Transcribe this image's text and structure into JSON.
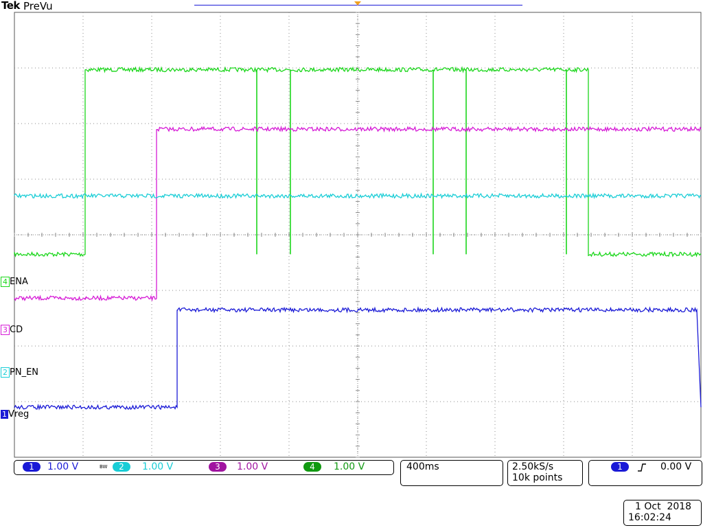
{
  "header": {
    "brand": "Tek",
    "mode": "PreVu"
  },
  "colors": {
    "ch1": "#1a1ad6",
    "ch2": "#19cdd6",
    "ch3": "#d61bd6",
    "ch4": "#1ad61a",
    "grid": "#8a8a8a",
    "trigger": "#f0a020"
  },
  "channels": [
    {
      "number": "1",
      "name": "Vreg",
      "scale": "1.00 V",
      "bw": "",
      "color": "#1a1ad6"
    },
    {
      "number": "2",
      "name": "PN_EN",
      "scale": "1.00 V",
      "bw": "B_W",
      "color": "#19cdd6"
    },
    {
      "number": "3",
      "name": "CD",
      "scale": "1.00 V",
      "bw": "",
      "color": "#d61bd6"
    },
    {
      "number": "4",
      "name": "ENA",
      "scale": "1.00 V",
      "bw": "",
      "color": "#1ad61a"
    }
  ],
  "bw_label": "BW",
  "timebase": {
    "per_div": "400ms"
  },
  "acquisition": {
    "sample_rate": "2.50kS/s",
    "record_length": "10k points"
  },
  "trigger": {
    "source": "1",
    "slope_icon": "rising-edge-icon",
    "level": "0.00 V"
  },
  "datetime": {
    "date": "1 Oct  2018",
    "time": "16:02:24"
  },
  "chart_data": {
    "type": "line",
    "title": "",
    "xlabel": "",
    "ylabel": "",
    "divisions": {
      "x": 10,
      "y": 8
    },
    "xlim": [
      0,
      10
    ],
    "ylim": [
      0,
      8
    ],
    "series": [
      {
        "name": "ENA",
        "channel": 4,
        "points": [
          [
            0,
            3.65
          ],
          [
            1.03,
            3.65
          ],
          [
            1.03,
            6.97
          ],
          [
            8.36,
            6.97
          ],
          [
            8.36,
            3.65
          ],
          [
            10,
            3.65
          ]
        ],
        "glitches_to": 3.65,
        "glitch_x": [
          3.53,
          4.02,
          6.1,
          6.58,
          8.04
        ]
      },
      {
        "name": "CD",
        "channel": 3,
        "points": [
          [
            0,
            2.86
          ],
          [
            0.67,
            2.86
          ],
          [
            0.84,
            2.86
          ],
          [
            1.03,
            2.86
          ],
          [
            2.07,
            2.86
          ],
          [
            2.07,
            5.9
          ],
          [
            10,
            5.9
          ]
        ]
      },
      {
        "name": "PN_EN",
        "channel": 2,
        "points": [
          [
            0,
            4.7
          ],
          [
            10,
            4.7
          ]
        ]
      },
      {
        "name": "Vreg",
        "channel": 1,
        "points": [
          [
            0,
            0.9
          ],
          [
            2.37,
            0.9
          ],
          [
            2.37,
            2.65
          ],
          [
            9.94,
            2.65
          ],
          [
            10.08,
            0.9
          ],
          [
            12.5,
            0.9
          ]
        ]
      }
    ]
  }
}
